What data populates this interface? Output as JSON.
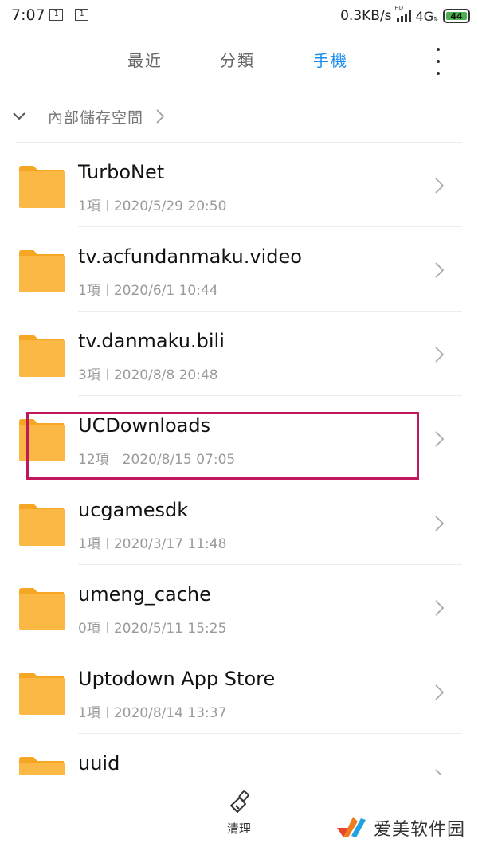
{
  "status_bar": {
    "time": "7:07",
    "sim1": "1",
    "sim2": "1",
    "speed": "0.3KB/s",
    "hd": "HD",
    "network": "4G",
    "battery": "44"
  },
  "tabs": [
    {
      "label": "最近"
    },
    {
      "label": "分類"
    },
    {
      "label": "手機"
    }
  ],
  "active_tab": "手機",
  "breadcrumb": {
    "label": "內部儲存空間"
  },
  "files": [
    {
      "name": "TurboNet",
      "count": "1項",
      "date": "2020/5/29 20:50"
    },
    {
      "name": "tv.acfundanmaku.video",
      "count": "1項",
      "date": "2020/6/1 10:44"
    },
    {
      "name": "tv.danmaku.bili",
      "count": "3項",
      "date": "2020/8/8 20:48"
    },
    {
      "name": "UCDownloads",
      "count": "12項",
      "date": "2020/8/15 07:05"
    },
    {
      "name": "ucgamesdk",
      "count": "1項",
      "date": "2020/3/17 11:48"
    },
    {
      "name": "umeng_cache",
      "count": "0項",
      "date": "2020/5/11 15:25"
    },
    {
      "name": "Uptodown App Store",
      "count": "1項",
      "date": "2020/8/14 13:37"
    },
    {
      "name": "uuid",
      "count": "",
      "date": ""
    }
  ],
  "bottom": {
    "clean_label": "清理"
  },
  "watermark": {
    "text": "爱美软件园"
  },
  "colors": {
    "accent": "#1a8df0",
    "folder": "#fbb845",
    "folder_tab": "#f5a623",
    "highlight": "#c0175d"
  },
  "icons": {
    "status": [
      "sim-card-icon",
      "signal-icon",
      "battery-icon"
    ],
    "header": "more-vertical-icon",
    "breadcrumb": [
      "chevron-down-icon",
      "chevron-right-icon"
    ],
    "rows": [
      "folder-icon",
      "chevron-right-icon"
    ],
    "bottom": "broom-icon"
  }
}
